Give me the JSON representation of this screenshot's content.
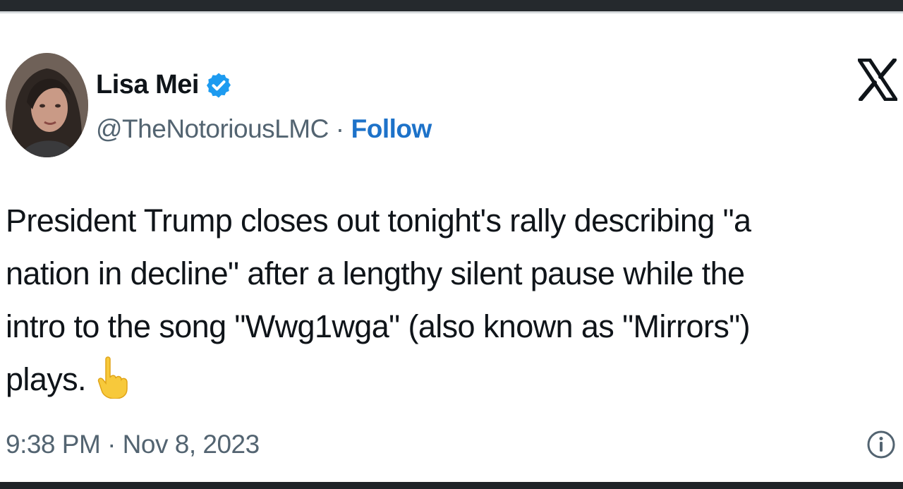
{
  "tweet": {
    "author_name": "Lisa Mei",
    "handle": "@TheNotoriousLMC",
    "separator": "·",
    "follow_label": "Follow",
    "lines": [
      "President Trump closes out tonight's rally describing \"a",
      "nation in decline\" after a lengthy silent pause while the",
      "intro to the song \"Wwg1wga\" (also known as \"Mirrors\")",
      "plays."
    ],
    "timestamp": "9:38 PM · Nov 8, 2023"
  },
  "icons": {
    "verified": "verified-badge-icon",
    "platform_logo": "x-logo-icon",
    "emoji": "pointing-down-hand-icon",
    "info": "info-icon"
  },
  "colors": {
    "accent": "#1d9bf0",
    "follow": "#1d72c9",
    "text": "#0f1419",
    "secondary": "#536471"
  }
}
